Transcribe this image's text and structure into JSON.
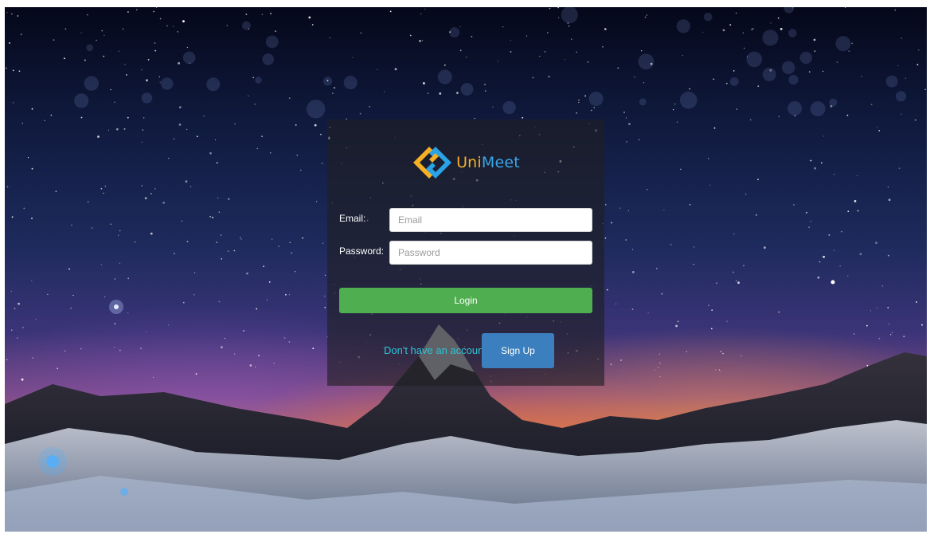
{
  "brand": {
    "name_accent": "Uni",
    "name_rest": "Meet",
    "logo_icon": "unimeet-logo-icon",
    "colors": {
      "orange": "#f5b025",
      "blue": "#3aa6e8"
    }
  },
  "form": {
    "email": {
      "label": "Email:",
      "placeholder": "Email",
      "value": ""
    },
    "password": {
      "label": "Password:",
      "placeholder": "Password",
      "value": ""
    },
    "login_label": "Login",
    "login_color": "#4fae4f"
  },
  "signup": {
    "prompt": "Don't have an account?",
    "button_label": "Sign Up",
    "button_color": "#3b7fbf",
    "prompt_color": "#2ec4d6"
  },
  "background": {
    "description_icon": "starry-night-mountain-background"
  }
}
